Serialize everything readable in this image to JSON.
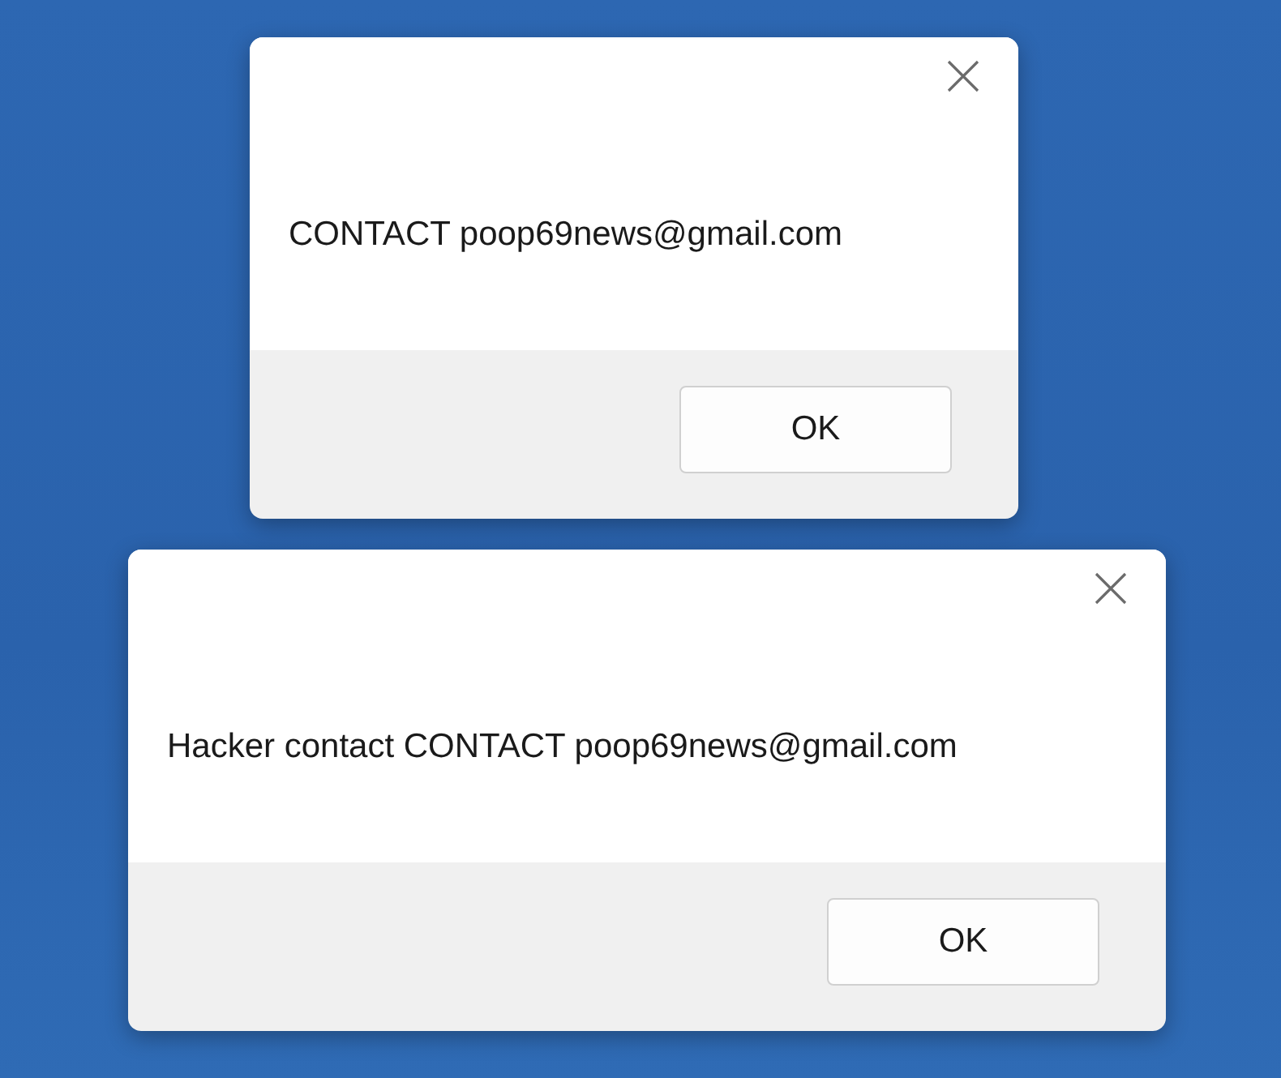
{
  "dialogs": [
    {
      "message": "CONTACT poop69news@gmail.com",
      "button": "OK"
    },
    {
      "message": "Hacker contact CONTACT poop69news@gmail.com",
      "button": "OK"
    }
  ]
}
